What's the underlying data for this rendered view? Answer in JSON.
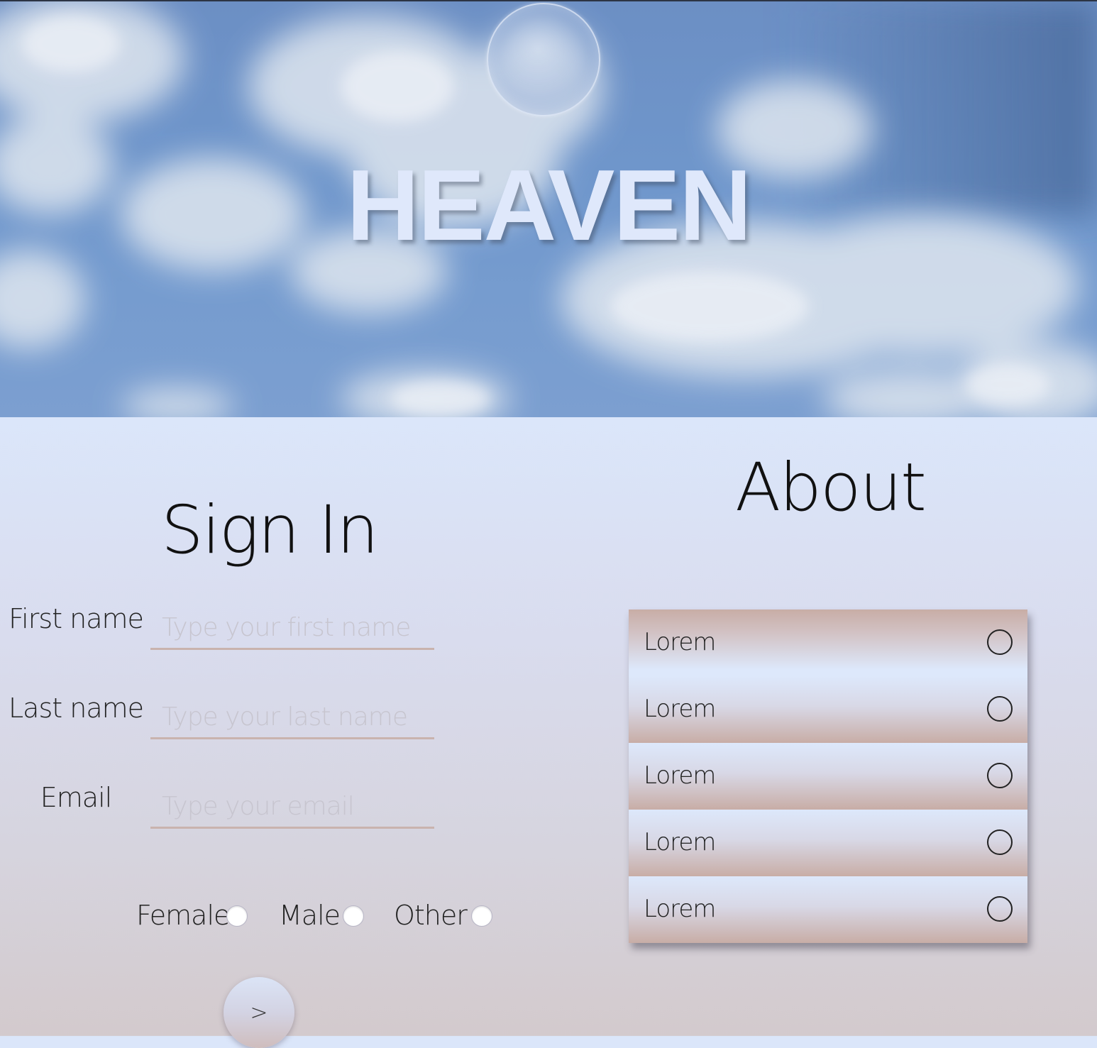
{
  "hero": {
    "title": "HEAVEN",
    "background": "sky-clouds-image",
    "moon_icon": "bubble-circle-icon"
  },
  "signin": {
    "title": "Sign In",
    "fields": [
      {
        "label": "First name",
        "placeholder": "Type your first name",
        "value": ""
      },
      {
        "label": "Last name",
        "placeholder": "Type your last name",
        "value": ""
      },
      {
        "label": "Email",
        "placeholder": "Type your email",
        "value": ""
      }
    ],
    "gender_options": [
      "Female",
      "Male",
      "Other"
    ],
    "submit_label": ">"
  },
  "about": {
    "title": "About",
    "items": [
      {
        "label": "Lorem",
        "icon": "circle-icon"
      },
      {
        "label": "Lorem",
        "icon": "circle-icon"
      },
      {
        "label": "Lorem",
        "icon": "circle-icon"
      },
      {
        "label": "Lorem",
        "icon": "circle-icon"
      },
      {
        "label": "Lorem",
        "icon": "circle-icon"
      }
    ]
  },
  "colors": {
    "accent_underline": "#c9b3ae",
    "hero_title": "#dfe8fb",
    "page_top": "#dbe6fa",
    "page_bottom": "#d3cacd"
  }
}
